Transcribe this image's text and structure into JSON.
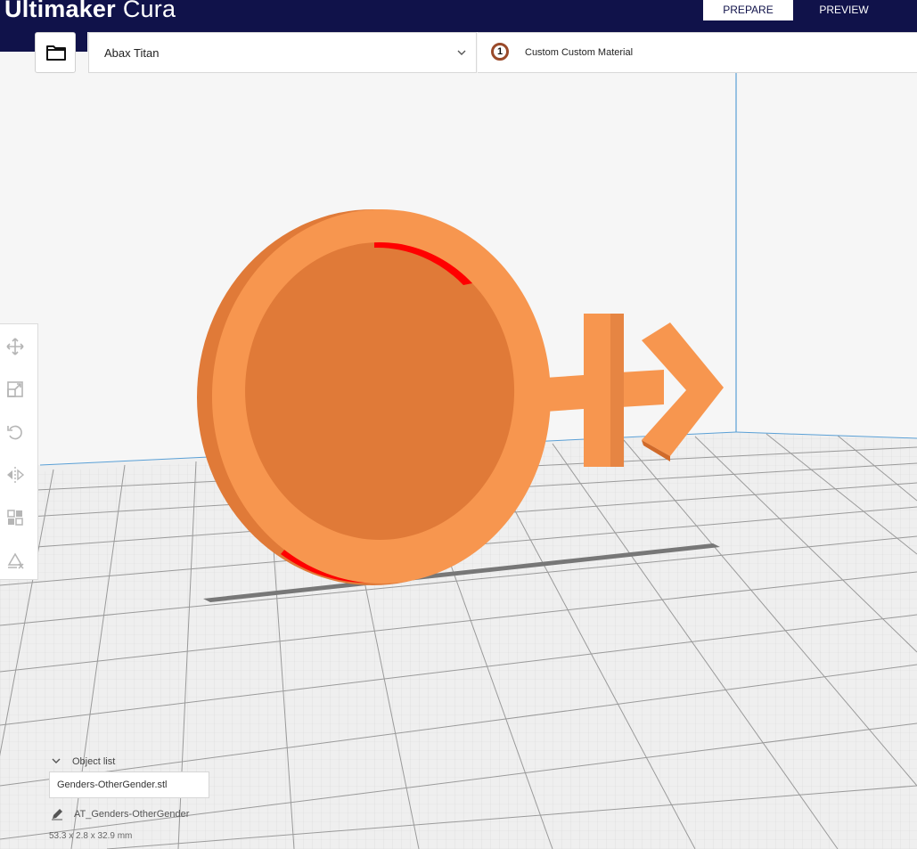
{
  "app": {
    "brand_bold": "Ultimaker",
    "brand_light": "Cura"
  },
  "stages": [
    {
      "label": "PREPARE",
      "active": true
    },
    {
      "label": "PREVIEW",
      "active": false
    }
  ],
  "toolbar": {
    "open_icon": "folder-icon",
    "printer_name": "Abax Titan",
    "extruder_number": "1",
    "material_name": "Custom Custom Material"
  },
  "tools": [
    {
      "name": "move-icon"
    },
    {
      "name": "scale-icon"
    },
    {
      "name": "rotate-icon"
    },
    {
      "name": "mirror-icon"
    },
    {
      "name": "per-model-settings-icon"
    },
    {
      "name": "support-blocker-icon"
    }
  ],
  "object_list": {
    "label": "Object list",
    "file_name": "Genders-OtherGender.stl",
    "item_name": "AT_Genders-OtherGender",
    "dimensions": "53.3 x 2.8 x 32.9 mm"
  },
  "colors": {
    "header": "#10124a",
    "model": "#f7964f",
    "model_shadow": "#e07a38",
    "overhang": "#ff0000",
    "build_volume_edge": "#5aa0d6"
  }
}
